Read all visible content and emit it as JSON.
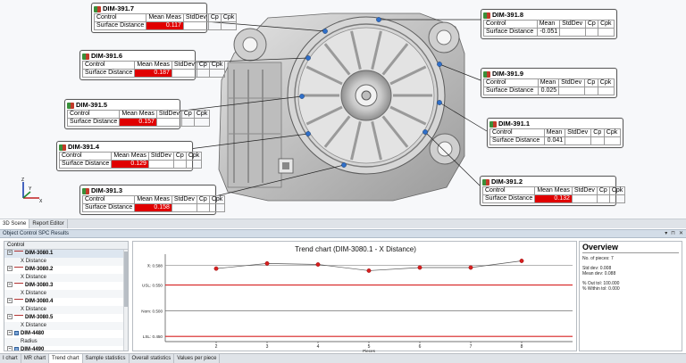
{
  "scene": {
    "callouts": [
      {
        "id": "c7",
        "name": "DIM-391.7",
        "headers": [
          "Control",
          "Mean Meas",
          "StdDev",
          "Cp",
          "Cpk"
        ],
        "label": "Surface Distance",
        "mean": "0.117",
        "stddev": "",
        "cp": "",
        "cpk": "",
        "out_of_tol": true
      },
      {
        "id": "c6",
        "name": "DIM-391.6",
        "headers": [
          "Control",
          "Mean Meas",
          "StdDev",
          "Cp",
          "Cpk"
        ],
        "label": "Surface Distance",
        "mean": "0.187",
        "stddev": "",
        "cp": "",
        "cpk": "",
        "out_of_tol": true
      },
      {
        "id": "c5",
        "name": "DIM-391.5",
        "headers": [
          "Control",
          "Mean Meas",
          "StdDev",
          "Cp",
          "Cpk"
        ],
        "label": "Surface Distance",
        "mean": "0.157",
        "stddev": "",
        "cp": "",
        "cpk": "",
        "out_of_tol": true
      },
      {
        "id": "c4",
        "name": "DIM-391.4",
        "headers": [
          "Control",
          "Mean Meas",
          "StdDev",
          "Cp",
          "Cpk"
        ],
        "label": "Surface Distance",
        "mean": "0.129",
        "stddev": "",
        "cp": "",
        "cpk": "",
        "out_of_tol": true
      },
      {
        "id": "c3",
        "name": "DIM-391.3",
        "headers": [
          "Control",
          "Mean Meas",
          "StdDev",
          "Cp",
          "Cpk"
        ],
        "label": "Surface Distance",
        "mean": "0.158",
        "stddev": "",
        "cp": "",
        "cpk": "",
        "out_of_tol": true
      },
      {
        "id": "c8",
        "name": "DIM-391.8",
        "headers": [
          "Control",
          "Mean",
          "StdDev",
          "Cp",
          "Cpk"
        ],
        "label": "Surface Distance",
        "mean": "-0.051",
        "stddev": "",
        "cp": "",
        "cpk": "",
        "out_of_tol": false
      },
      {
        "id": "c9",
        "name": "DIM-391.9",
        "headers": [
          "Control",
          "Mean",
          "StdDev",
          "Cp",
          "Cpk"
        ],
        "label": "Surface Distance",
        "mean": "0.025",
        "stddev": "",
        "cp": "",
        "cpk": "",
        "out_of_tol": false
      },
      {
        "id": "c1",
        "name": "DIM-391.1",
        "headers": [
          "Control",
          "Mean",
          "StdDev",
          "Cp",
          "Cpk"
        ],
        "label": "Surface Distance",
        "mean": "0.041",
        "stddev": "",
        "cp": "",
        "cpk": "",
        "out_of_tol": false
      },
      {
        "id": "c2",
        "name": "DIM-391.2",
        "headers": [
          "Control",
          "Mean Meas",
          "StdDev",
          "Cp",
          "Cpk"
        ],
        "label": "Surface Distance",
        "mean": "0.132",
        "stddev": "",
        "cp": "",
        "cpk": "",
        "out_of_tol": true
      }
    ],
    "axis_labels": {
      "z": "Z",
      "y": "Y",
      "x": "X"
    }
  },
  "top_tabs": [
    {
      "label": "3D Scene",
      "active": true
    },
    {
      "label": "Report Editor",
      "active": false
    }
  ],
  "spc": {
    "title": "Object Control SPC Results",
    "controls": [
      "▾",
      "⊓",
      "✕"
    ]
  },
  "tree": {
    "header": "Control",
    "rows": [
      {
        "kind": "parent",
        "label": "DIM-3080.1",
        "icon": "dimension-icon",
        "selected": true
      },
      {
        "kind": "child",
        "label": "X Distance"
      },
      {
        "kind": "parent",
        "label": "DIM-3080.2",
        "icon": "dimension-icon"
      },
      {
        "kind": "child",
        "label": "X Distance"
      },
      {
        "kind": "parent",
        "label": "DIM-3080.3",
        "icon": "dimension-icon"
      },
      {
        "kind": "child",
        "label": "X Distance"
      },
      {
        "kind": "parent",
        "label": "DIM-3080.4",
        "icon": "dimension-icon"
      },
      {
        "kind": "child",
        "label": "X Distance"
      },
      {
        "kind": "parent",
        "label": "DIM-3080.5",
        "icon": "dimension-icon"
      },
      {
        "kind": "child",
        "label": "X Distance"
      },
      {
        "kind": "parent",
        "label": "DIM-4480",
        "icon": "radius-icon"
      },
      {
        "kind": "child",
        "label": "Radius"
      },
      {
        "kind": "parent",
        "label": "DIM-4490",
        "icon": "radius-icon"
      }
    ]
  },
  "chart_data": {
    "type": "line",
    "title": "Trend chart (DIM-3080.1 - X Distance)",
    "xlabel": "Pieces",
    "ylabel": "",
    "x": [
      2,
      3,
      4,
      5,
      6,
      7,
      8
    ],
    "y": [
      0.582,
      0.592,
      0.59,
      0.578,
      0.584,
      0.584,
      0.597
    ],
    "x_ticks": [
      "2",
      "3",
      "4",
      "5",
      "6",
      "7",
      "8"
    ],
    "xlim": [
      1,
      9
    ],
    "ylim": [
      0.44,
      0.61
    ],
    "reference_lines": [
      {
        "label": "X̄: 0.588",
        "value": 0.588,
        "color": "#888888"
      },
      {
        "label": "USL: 0.550",
        "value": 0.55,
        "color": "#d62020"
      },
      {
        "label": "Nom: 0.500",
        "value": 0.5,
        "color": "#555555"
      },
      {
        "label": "LSL: 0.450",
        "value": 0.45,
        "color": "#d62020"
      }
    ],
    "series_color": "#d62020",
    "grid": false
  },
  "overview": {
    "title": "Overview",
    "lines": [
      "No. of pieces: 7",
      "",
      "Std dev: 0.008",
      "Mean dev: 0.088",
      "",
      "% Out tol: 100.000",
      "% Within tol: 0.000"
    ]
  },
  "bottom_tabs": [
    {
      "label": "I chart",
      "active": false
    },
    {
      "label": "MR chart",
      "active": false
    },
    {
      "label": "Trend chart",
      "active": true
    },
    {
      "label": "Sample statistics",
      "active": false
    },
    {
      "label": "Overall statistics",
      "active": false
    },
    {
      "label": "Values per piece",
      "active": false
    }
  ],
  "colors": {
    "out_of_tol": "#e00000",
    "accent": "#2f5f9a"
  }
}
